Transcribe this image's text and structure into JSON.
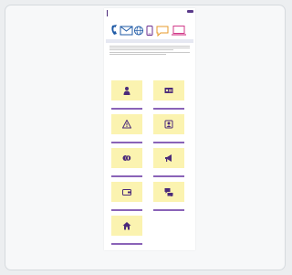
{
  "header": {
    "brand": "",
    "utility_links": "",
    "nav_items": [
      "",
      "",
      "",
      "",
      "",
      "",
      "",
      ""
    ]
  },
  "banner": {
    "icons": [
      "phone-icon",
      "letter-icon",
      "globe-icon",
      "mobile-icon",
      "chat-bubble-icon",
      "laptop-icon"
    ],
    "colors": {
      "blue": "#1f5aa6",
      "purple": "#6b2e8f",
      "orange": "#e79a2a",
      "pink": "#d23b8a"
    }
  },
  "main": {
    "page_title": "",
    "intro_heading": "",
    "tiles": [
      {
        "icon": "person-icon",
        "title": "",
        "desc": ""
      },
      {
        "icon": "id-card-icon",
        "title": "",
        "desc": ""
      },
      {
        "icon": "warning-triangle-icon",
        "title": "",
        "desc": ""
      },
      {
        "icon": "contact-card-icon",
        "title": "",
        "desc": ""
      },
      {
        "icon": "pound-coins-icon",
        "title": "",
        "desc": ""
      },
      {
        "icon": "megaphone-icon",
        "title": "",
        "desc": ""
      },
      {
        "icon": "wallet-icon",
        "title": "",
        "desc": ""
      },
      {
        "icon": "speech-bubbles-icon",
        "title": "",
        "desc": ""
      },
      {
        "icon": "house-icon",
        "title": "",
        "desc": ""
      }
    ]
  },
  "footer": {
    "left": "",
    "right": ""
  },
  "colors": {
    "accent": "#4b2a7a",
    "tile_bar": "#8a63b8",
    "tile_background": "#fbf3b0",
    "icon_color": "#4b2a7a",
    "page_background": "#ffffff",
    "outer_background": "#eceef0"
  }
}
